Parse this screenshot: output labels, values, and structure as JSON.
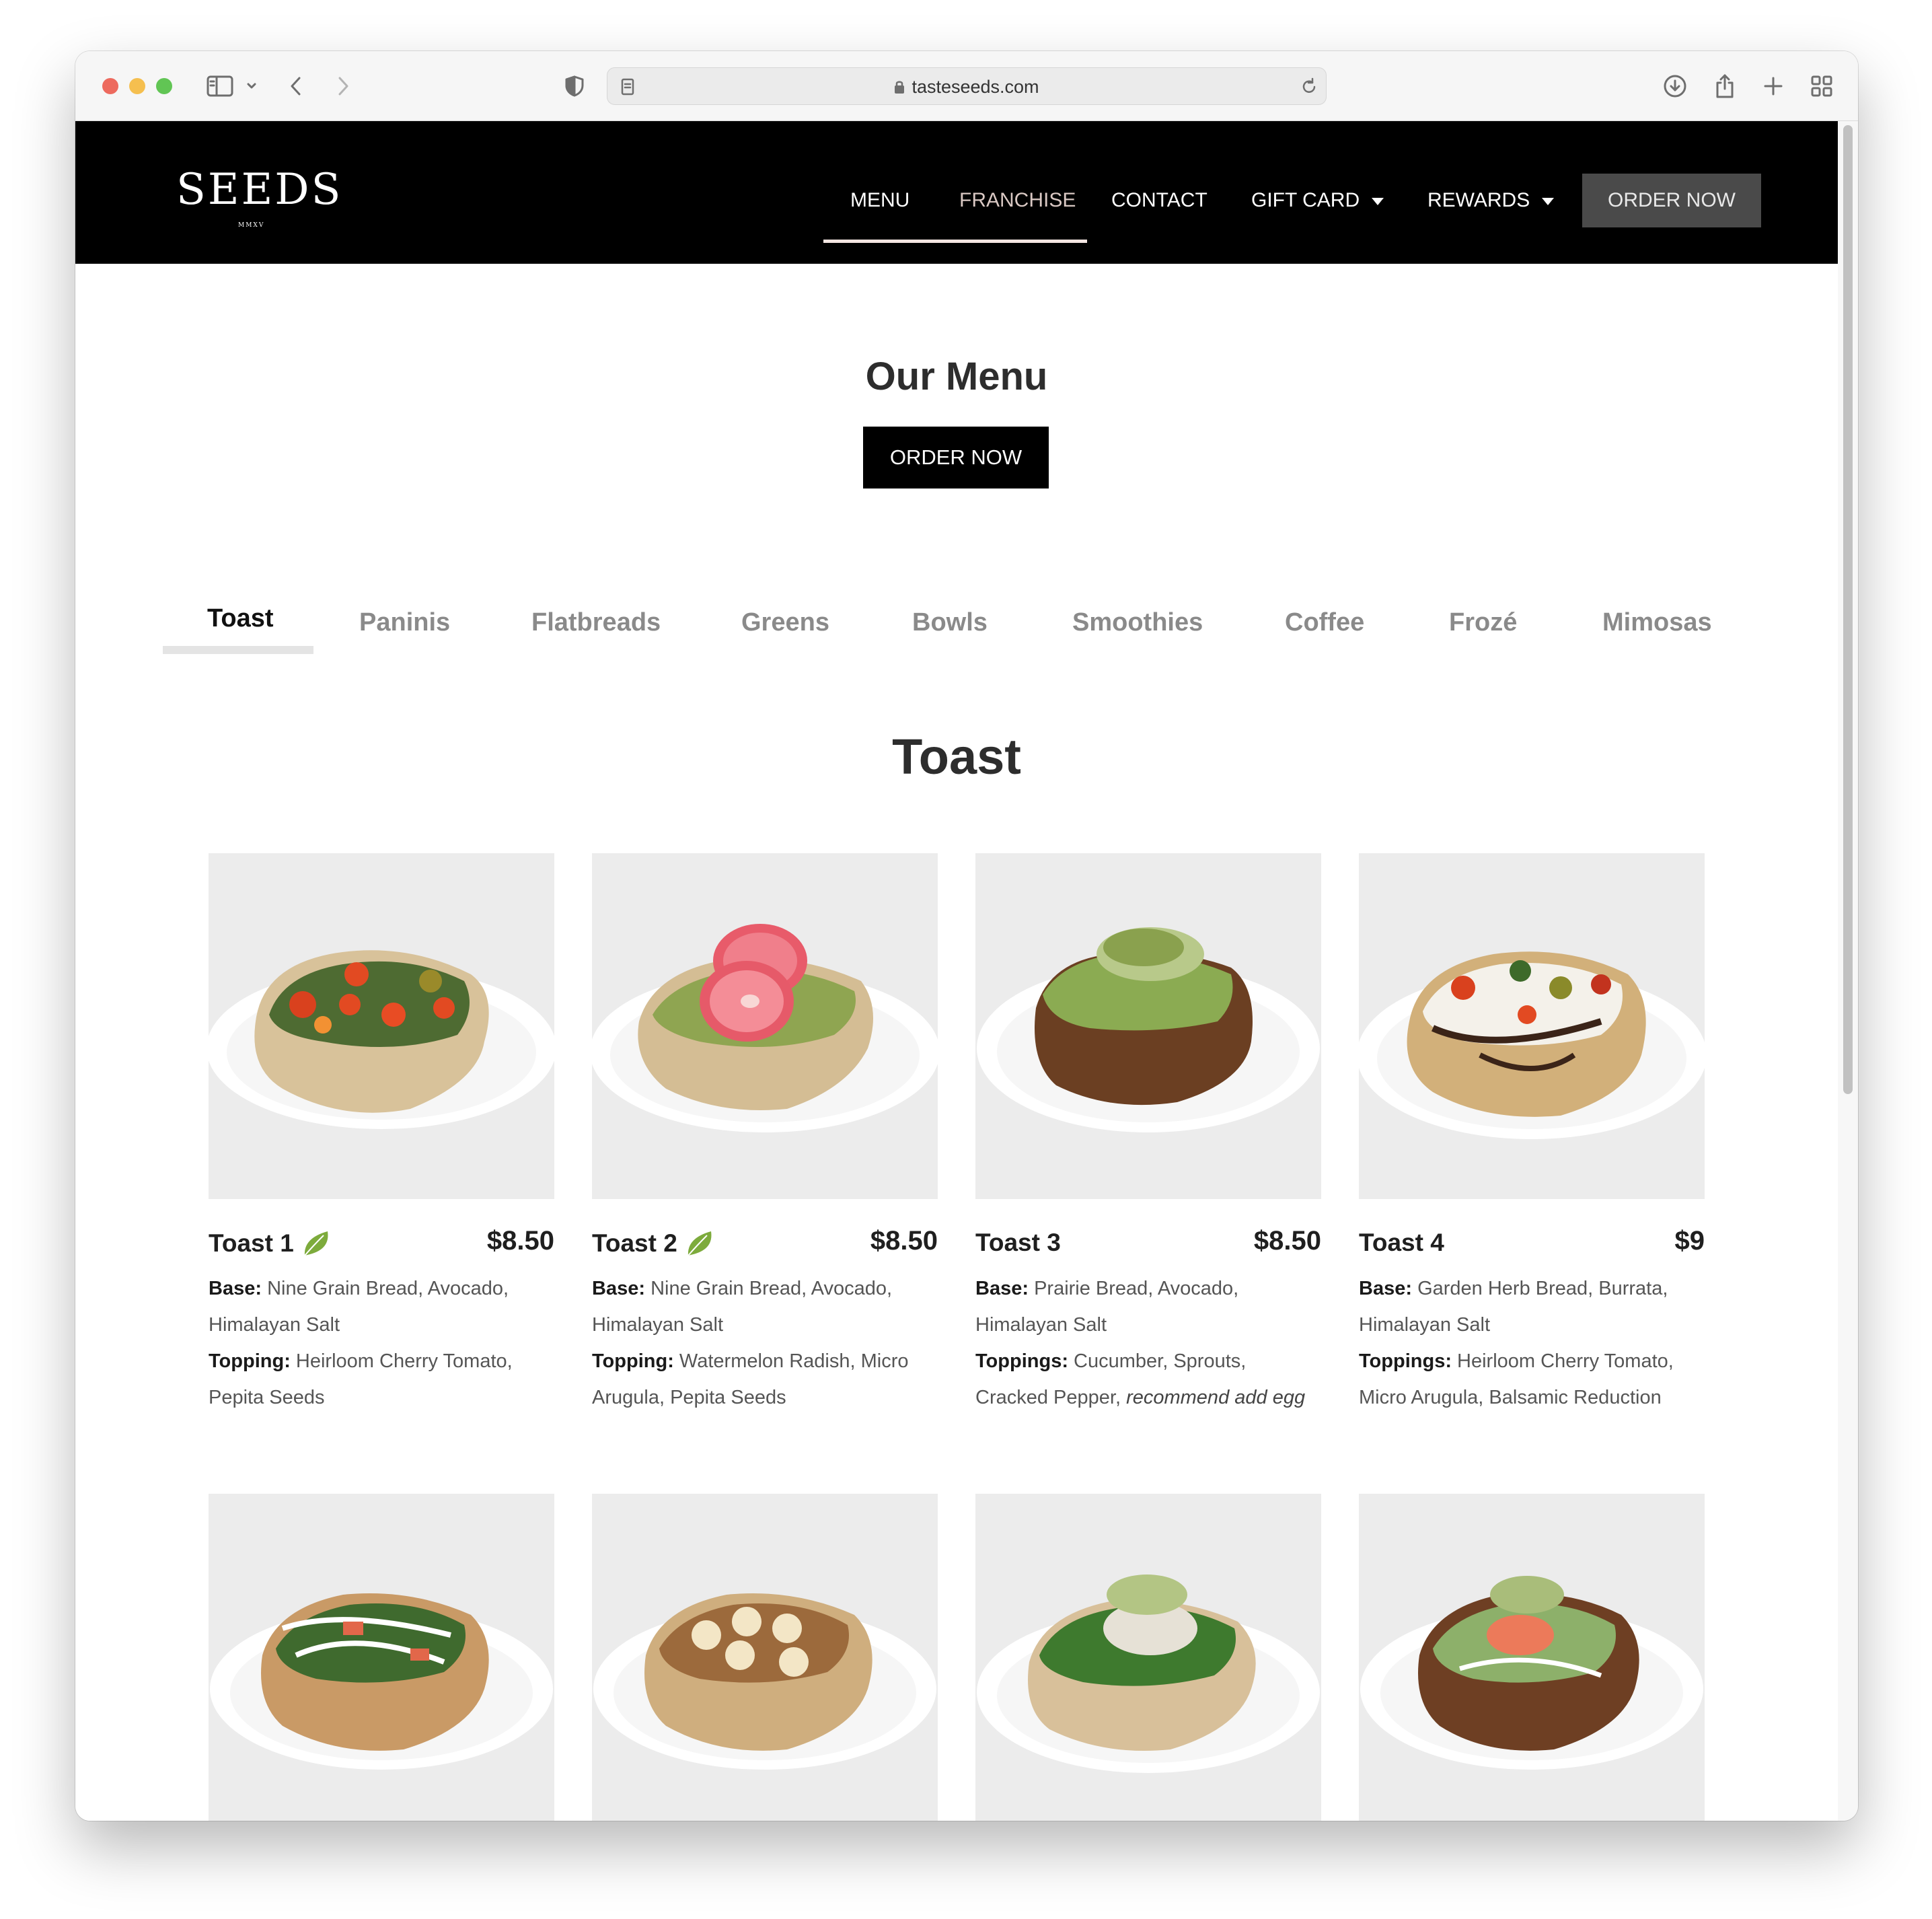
{
  "browser": {
    "url": "tasteseeds.com"
  },
  "header": {
    "logo": "SEEDS",
    "logo_sub": "MMXV",
    "nav": {
      "menu": "MENU",
      "franchise": "FRANCHISE",
      "contact": "CONTACT",
      "gift_card": "GIFT CARD",
      "rewards": "REWARDS"
    },
    "order_button": "ORDER NOW"
  },
  "main": {
    "title": "Our Menu",
    "order_button": "ORDER NOW",
    "tabs": [
      "Toast",
      "Paninis",
      "Flatbreads",
      "Greens",
      "Bowls",
      "Smoothies",
      "Coffee",
      "Frozé",
      "Mimosas"
    ],
    "active_tab": "Toast",
    "section_title": "Toast"
  },
  "items": [
    {
      "name": "Toast 1",
      "vegetarian": true,
      "price": "$8.50",
      "base_label": "Base:",
      "base": "Nine Grain Bread, Avocado, Himalayan Salt",
      "topping_label": "Topping:",
      "topping": "Heirloom Cherry Tomato, Pepita Seeds"
    },
    {
      "name": "Toast 2",
      "vegetarian": true,
      "price": "$8.50",
      "base_label": "Base:",
      "base": "Nine Grain Bread, Avocado, Himalayan Salt",
      "topping_label": "Topping:",
      "topping": "Watermelon Radish, Micro Arugula, Pepita Seeds"
    },
    {
      "name": "Toast 3",
      "vegetarian": false,
      "price": "$8.50",
      "base_label": "Base:",
      "base": "Prairie Bread, Avocado, Himalayan Salt",
      "topping_label": "Toppings:",
      "topping": "Cucumber, Sprouts, Cracked Pepper,",
      "topping_note": "recommend add egg"
    },
    {
      "name": "Toast 4",
      "vegetarian": false,
      "price": "$9",
      "base_label": "Base:",
      "base": "Garden Herb Bread, Burrata, Himalayan Salt",
      "topping_label": "Toppings:",
      "topping": "Heirloom Cherry Tomato, Micro Arugula, Balsamic Reduction"
    }
  ],
  "colors": {
    "header_bg": "#000000",
    "accent_leaf": "#7dab3c",
    "order_header_bg": "#4a4a4a",
    "tab_underline": "#e4e4e4"
  }
}
